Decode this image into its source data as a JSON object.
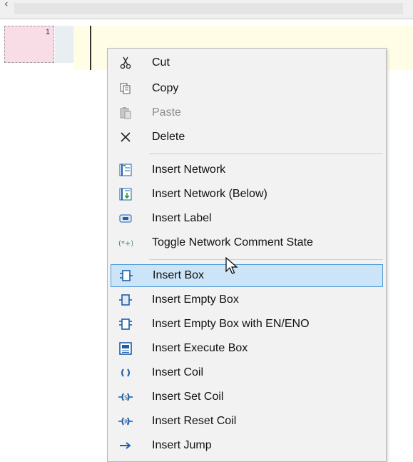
{
  "editor": {
    "network_number": "1"
  },
  "menu": {
    "items": [
      {
        "label": "Cut",
        "icon": "scissors-icon"
      },
      {
        "label": "Copy",
        "icon": "copy-icon"
      },
      {
        "label": "Paste",
        "icon": "paste-icon",
        "disabled": true
      },
      {
        "label": "Delete",
        "icon": "delete-icon"
      },
      {
        "label": "Insert Network",
        "icon": "insert-network-icon"
      },
      {
        "label": "Insert Network (Below)",
        "icon": "insert-network-below-icon"
      },
      {
        "label": "Insert Label",
        "icon": "insert-label-icon"
      },
      {
        "label": "Toggle Network Comment State",
        "icon": "comment-toggle-icon"
      },
      {
        "label": "Insert Box",
        "icon": "box-icon",
        "highlighted": true
      },
      {
        "label": "Insert Empty Box",
        "icon": "empty-box-icon"
      },
      {
        "label": "Insert Empty Box with EN/ENO",
        "icon": "box-en-eno-icon"
      },
      {
        "label": "Insert Execute Box",
        "icon": "execute-box-icon"
      },
      {
        "label": "Insert Coil",
        "icon": "coil-icon"
      },
      {
        "label": "Insert Set Coil",
        "icon": "set-coil-icon"
      },
      {
        "label": "Insert Reset Coil",
        "icon": "reset-coil-icon"
      },
      {
        "label": "Insert Jump",
        "icon": "jump-icon"
      }
    ]
  },
  "colors": {
    "highlight_bg": "#cce4f7",
    "highlight_border": "#4e9ad8",
    "menu_bg": "#f2f2f2",
    "network_number_bg": "#f9dde6",
    "rung_bg": "#fffde6",
    "icon_blue": "#1f5fa8"
  }
}
